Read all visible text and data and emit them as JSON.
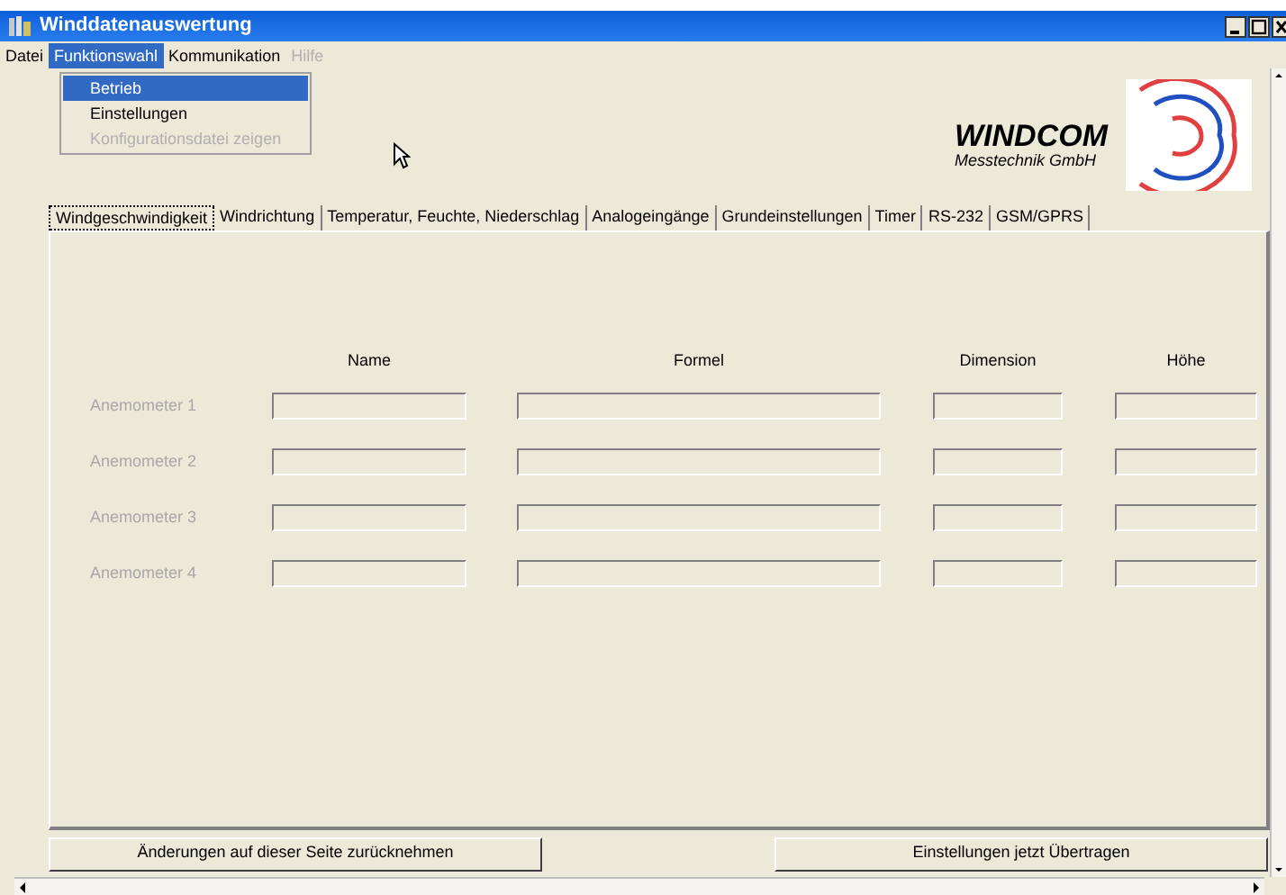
{
  "window": {
    "title": "Winddatenauswertung"
  },
  "menu": [
    {
      "label": "Datei",
      "selected": false,
      "disabled": false
    },
    {
      "label": "Funktionswahl",
      "selected": true,
      "disabled": false
    },
    {
      "label": "Kommunikation",
      "selected": false,
      "disabled": false
    },
    {
      "label": "Hilfe",
      "selected": false,
      "disabled": true
    }
  ],
  "dropdown": [
    {
      "label": "Betrieb",
      "selected": true,
      "disabled": false
    },
    {
      "label": "Einstellungen",
      "selected": false,
      "disabled": false
    },
    {
      "label": "Konfigurationsdatei zeigen",
      "selected": false,
      "disabled": true
    }
  ],
  "logo": {
    "name": "WINDCOM",
    "subtitle": "Messtechnik GmbH"
  },
  "tabs": [
    {
      "label": "Windgeschwindigkeit",
      "selected": true
    },
    {
      "label": "Windrichtung",
      "selected": false
    },
    {
      "label": "Temperatur, Feuchte, Niederschlag",
      "selected": false
    },
    {
      "label": "Analogeingänge",
      "selected": false
    },
    {
      "label": "Grundeinstellungen",
      "selected": false
    },
    {
      "label": "Timer",
      "selected": false
    },
    {
      "label": "RS-232",
      "selected": false
    },
    {
      "label": "GSM/GPRS",
      "selected": false
    }
  ],
  "table": {
    "columns": [
      "Name",
      "Formel",
      "Dimension",
      "Höhe"
    ],
    "rows": [
      {
        "label": "Anemometer 1",
        "disabled": true
      },
      {
        "label": "Anemometer 2",
        "disabled": true
      },
      {
        "label": "Anemometer 3",
        "disabled": true
      },
      {
        "label": "Anemometer 4",
        "disabled": true
      }
    ]
  },
  "buttons": [
    "Änderungen auf dieser Seite zurücknehmen",
    "Einstellungen jetzt Übertragen"
  ]
}
